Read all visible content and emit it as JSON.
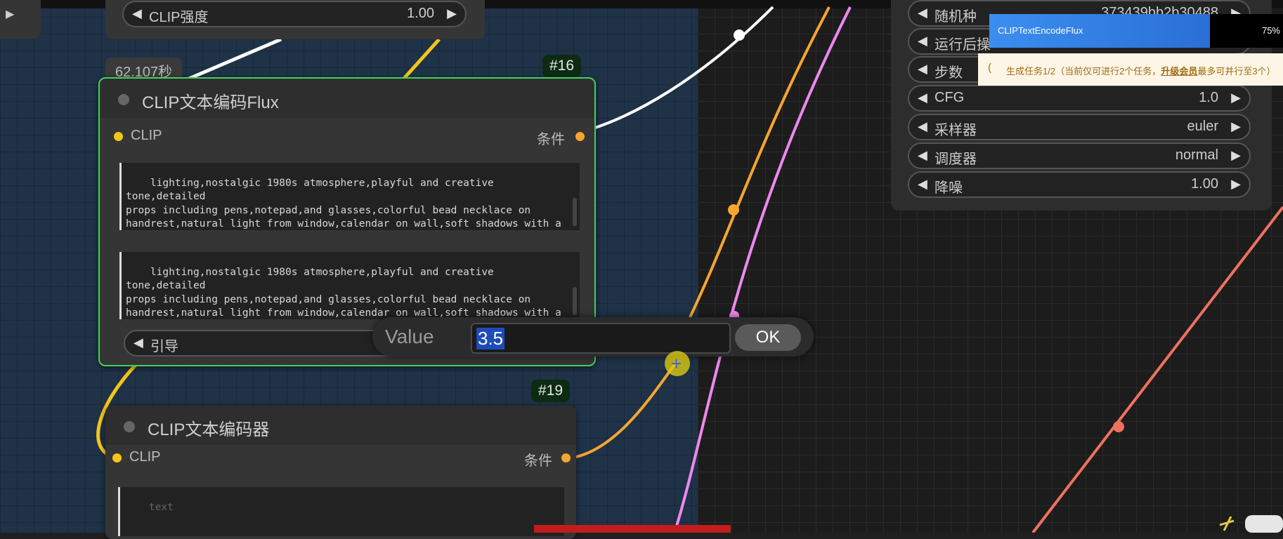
{
  "top_node": {
    "edge_arrow": "▶",
    "clip_strength_widget": {
      "label": "CLIP强度",
      "value": "1.00"
    }
  },
  "node16": {
    "id_badge": "#16",
    "time_label": "62.107秒",
    "title": "CLIP文本编码Flux",
    "input_label": "CLIP",
    "output_label": "条件",
    "text_a": "lighting,nostalgic 1980s atmosphere,playful and creative tone,detailed\nprops including pens,notepad,and glasses,colorful bead necklace on\nhandrest,natural light from window,calendar on wall,soft shadows with a\nwarm color palette,clear and sharp image quality,comfortable and cozy\nmood.,",
    "text_b": "lighting,nostalgic 1980s atmosphere,playful and creative tone,detailed\nprops including pens,notepad,and glasses,colorful bead necklace on\nhandrest,natural light from window,calendar on wall,soft shadows with a\nwarm color palette,clear and sharp image quality,comfortable and cozy\nmood.,",
    "guidance_widget": {
      "label": "引导"
    }
  },
  "node19": {
    "id_badge": "#19",
    "title": "CLIP文本编码器",
    "input_label": "CLIP",
    "output_label": "条件",
    "text_placeholder": "text"
  },
  "value_dialog": {
    "label": "Value",
    "value": "3.5",
    "ok_label": "OK"
  },
  "sampler_panel": {
    "widgets": [
      {
        "label": "随机种",
        "value": "373439bb2b30488"
      },
      {
        "label": "运行后操",
        "value": ""
      },
      {
        "label": "步数",
        "value": ""
      },
      {
        "label": "CFG",
        "value": "1.0"
      },
      {
        "label": "采样器",
        "value": "euler"
      },
      {
        "label": "调度器",
        "value": "normal"
      },
      {
        "label": "降噪",
        "value": "1.00"
      }
    ]
  },
  "progress": {
    "node_name": "CLIPTextEncodeFlux",
    "percent_text": "75%",
    "fraction": 0.75
  },
  "notice": {
    "prefix": "生成任务1/2（当前仅可进行2个任务，",
    "link": "升级会员",
    "suffix": "最多可并行至3个）"
  },
  "colors": {
    "clip_link": "#f5c518",
    "cond_link": "#f5a530",
    "white_link": "#ffffff",
    "pink_link": "#ee88ee",
    "salmon_link": "#f07060",
    "selected_border": "#3fd35a"
  }
}
